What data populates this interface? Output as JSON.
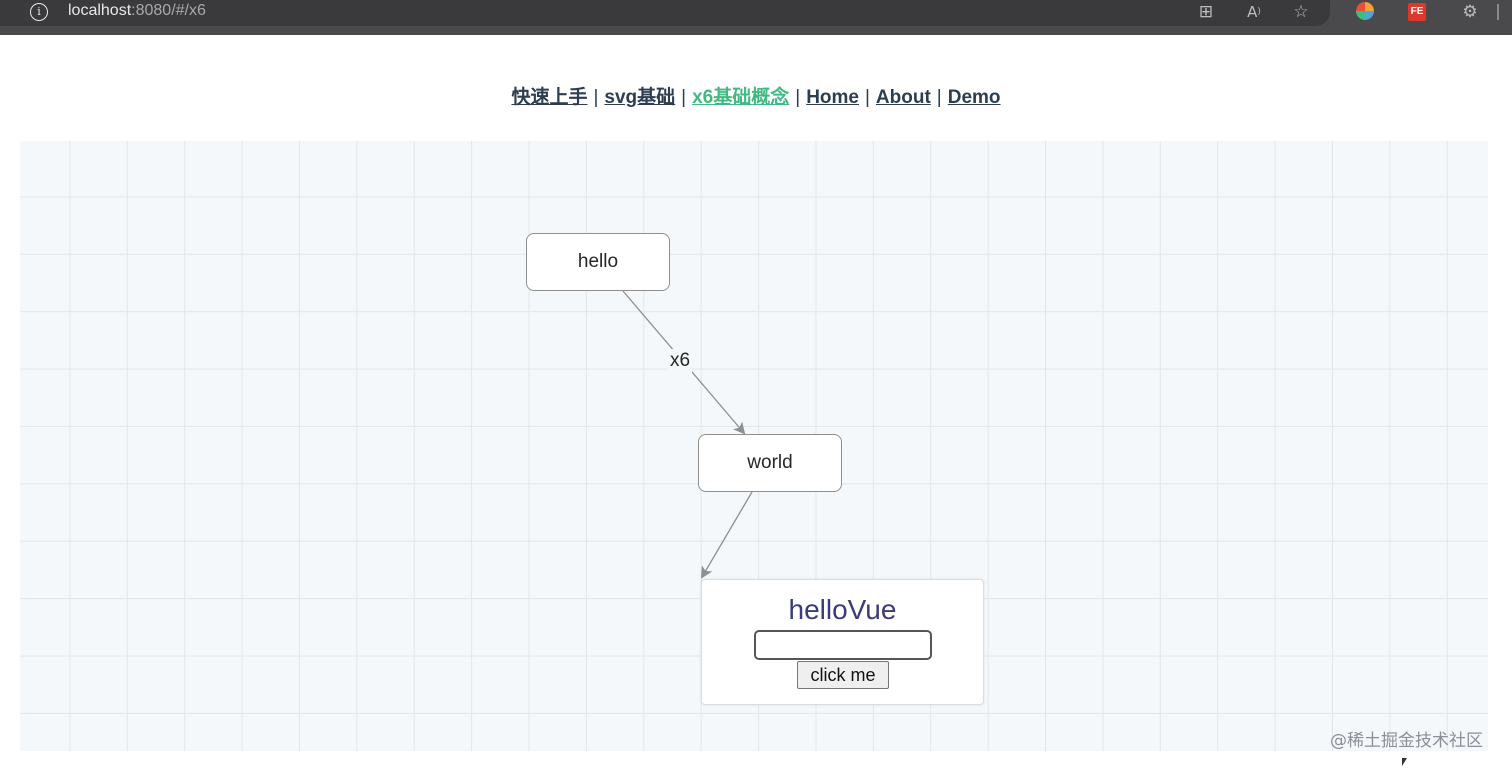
{
  "browser": {
    "url_host": "localhost",
    "url_rest": ":8080/#/x6",
    "info_icon_glyph": "i",
    "toolbar_icons": [
      "app-grid-icon",
      "read-aloud-icon",
      "favorite-star-icon",
      "color-extension-icon",
      "fe-extension-icon",
      "extensions-puzzle-icon"
    ],
    "fe_badge_label": "FE"
  },
  "nav": {
    "items": [
      {
        "label": "快速上手",
        "active": false
      },
      {
        "label": "svg基础",
        "active": false
      },
      {
        "label": "x6基础概念",
        "active": true
      },
      {
        "label": "Home",
        "active": false
      },
      {
        "label": "About",
        "active": false
      },
      {
        "label": "Demo",
        "active": false
      }
    ],
    "separator": "|",
    "active_color": "#42b983",
    "text_color": "#2c3e50"
  },
  "graph": {
    "nodes": {
      "hello": "hello",
      "world": "world"
    },
    "edge_label": "x6",
    "vue_node": {
      "title": "helloVue",
      "input_value": "",
      "button_label": "click me"
    }
  },
  "watermark": "@稀土掘金技术社区"
}
